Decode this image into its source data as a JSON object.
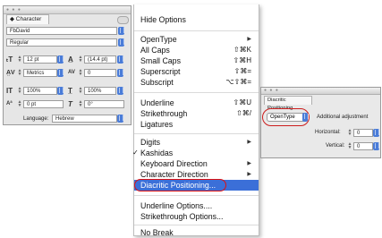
{
  "character_panel": {
    "tab_label": "◆ Character",
    "font_family": "FbDavid",
    "font_style": "Regular",
    "font_size": "12 pt",
    "leading": "(14.4 pt)",
    "kerning": "Metrics",
    "tracking": "0",
    "vertical_scale": "100%",
    "horizontal_scale": "100%",
    "baseline_shift": "0 pt",
    "skew": "0°",
    "language_label": "Language:",
    "language_value": "Hebrew"
  },
  "menu": {
    "items": [
      {
        "label": "Hide Options",
        "shortcut": "",
        "submenu": false
      },
      {
        "label": "OpenType",
        "shortcut": "",
        "submenu": true
      },
      {
        "label": "All Caps",
        "shortcut": "⇧⌘K",
        "submenu": false
      },
      {
        "label": "Small Caps",
        "shortcut": "⇧⌘H",
        "submenu": false
      },
      {
        "label": "Superscript",
        "shortcut": "⇧⌘=",
        "submenu": false
      },
      {
        "label": "Subscript",
        "shortcut": "⌥⇧⌘=",
        "submenu": false
      },
      {
        "label": "Underline",
        "shortcut": "⇧⌘U",
        "submenu": false
      },
      {
        "label": "Strikethrough",
        "shortcut": "⇧⌘/",
        "submenu": false
      },
      {
        "label": "Ligatures",
        "shortcut": "",
        "submenu": false
      },
      {
        "label": "Digits",
        "shortcut": "",
        "submenu": true
      },
      {
        "label": "Kashidas",
        "shortcut": "",
        "submenu": false,
        "checked": true
      },
      {
        "label": "Keyboard Direction",
        "shortcut": "",
        "submenu": true
      },
      {
        "label": "Character Direction",
        "shortcut": "",
        "submenu": true
      },
      {
        "label": "Diacritic Positioning...",
        "shortcut": "",
        "submenu": false,
        "selected": true
      },
      {
        "label": "Underline Options....",
        "shortcut": "",
        "submenu": false
      },
      {
        "label": "Strikethrough Options...",
        "shortcut": "",
        "submenu": false
      },
      {
        "label": "No Break",
        "shortcut": "",
        "submenu": false
      }
    ],
    "check_glyph": "✓",
    "arrow_glyph": "▶"
  },
  "diacritic_panel": {
    "tab_label": "Diacritic Positioning",
    "mode_value": "OpenType",
    "additional_label": "Additional adjustment",
    "horizontal_label": "Horizontal:",
    "horizontal_value": "0",
    "vertical_label": "Vertical:",
    "vertical_value": "0"
  },
  "colors": {
    "selection": "#3b6fd8",
    "annotation": "#d11d1d",
    "stepper": "#4a7cd8"
  }
}
